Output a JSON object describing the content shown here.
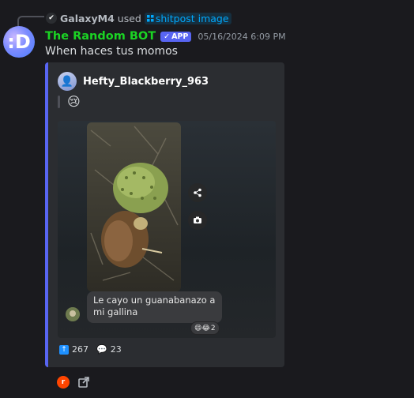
{
  "reply": {
    "username": "GalaxyM4",
    "action": "used",
    "command_icon": "grid-icon",
    "command": "shitpost image"
  },
  "message": {
    "bot_name": "The Random BOT",
    "bot_name_color": "#1bd424",
    "badge_check": "✓",
    "badge": "APP",
    "timestamp": "05/16/2024 6:09 PM",
    "text": "When haces tus momos"
  },
  "embed": {
    "author": "Hefty_Blackberry_963",
    "quote_emoji": "😢",
    "caption": "Le cayo un guanabanazo a mi gallina",
    "reactions_emoji": "😄😂",
    "reactions_count": "2",
    "upvotes": "267",
    "comments": "23",
    "accent_color": "#5865f2"
  },
  "bottom_icons": [
    "reddit-icon",
    "external-link-icon"
  ]
}
